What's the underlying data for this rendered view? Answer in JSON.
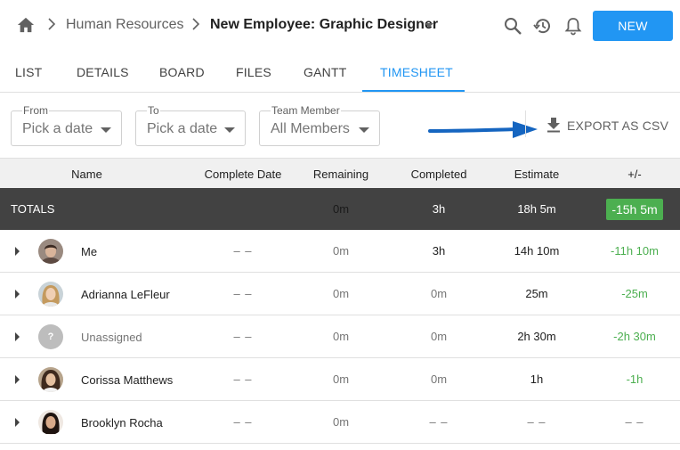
{
  "breadcrumb": {
    "parent": "Human Resources",
    "current": "New Employee: Graphic Designer"
  },
  "toolbar": {
    "new_label": "NEW"
  },
  "tabs": [
    {
      "label": "LIST"
    },
    {
      "label": "DETAILS"
    },
    {
      "label": "BOARD"
    },
    {
      "label": "FILES"
    },
    {
      "label": "GANTT"
    },
    {
      "label": "TIMESHEET",
      "active": true
    }
  ],
  "filters": {
    "from": {
      "label": "From",
      "value": "Pick a date"
    },
    "to": {
      "label": "To",
      "value": "Pick a date"
    },
    "team": {
      "label": "Team Member",
      "value": "All Members"
    }
  },
  "export": {
    "label": "EXPORT AS CSV"
  },
  "table": {
    "columns": [
      "Name",
      "Complete Date",
      "Remaining",
      "Completed",
      "Estimate",
      "+/-"
    ],
    "totals": {
      "label": "TOTALS",
      "remaining": "0m",
      "completed": "3h",
      "estimate": "18h 5m",
      "diff": "-15h 5m"
    },
    "rows": [
      {
        "name": "Me",
        "complete_date": "– –",
        "remaining": "0m",
        "completed": "3h",
        "estimate": "14h 10m",
        "diff": "-11h 10m"
      },
      {
        "name": "Adrianna LeFleur",
        "complete_date": "– –",
        "remaining": "0m",
        "completed": "0m",
        "estimate": "25m",
        "diff": "-25m"
      },
      {
        "name": "Unassigned",
        "avatar_text": "?",
        "complete_date": "– –",
        "remaining": "0m",
        "completed": "0m",
        "estimate": "2h 30m",
        "diff": "-2h 30m"
      },
      {
        "name": "Corissa Matthews",
        "complete_date": "– –",
        "remaining": "0m",
        "completed": "0m",
        "estimate": "1h",
        "diff": "-1h"
      },
      {
        "name": "Brooklyn Rocha",
        "complete_date": "– –",
        "remaining": "0m",
        "completed": "– –",
        "estimate": "– –",
        "diff": "– –"
      }
    ]
  },
  "colors": {
    "accent": "#2196f3",
    "totals_bg": "#424242",
    "positive_green": "#4caf50",
    "header_bg": "#f0f0f0"
  },
  "icons": [
    "home-icon",
    "chevron-right-icon",
    "search-icon",
    "history-icon",
    "bell-icon",
    "download-icon",
    "expand-arrow-icon",
    "dropdown-caret-icon"
  ]
}
